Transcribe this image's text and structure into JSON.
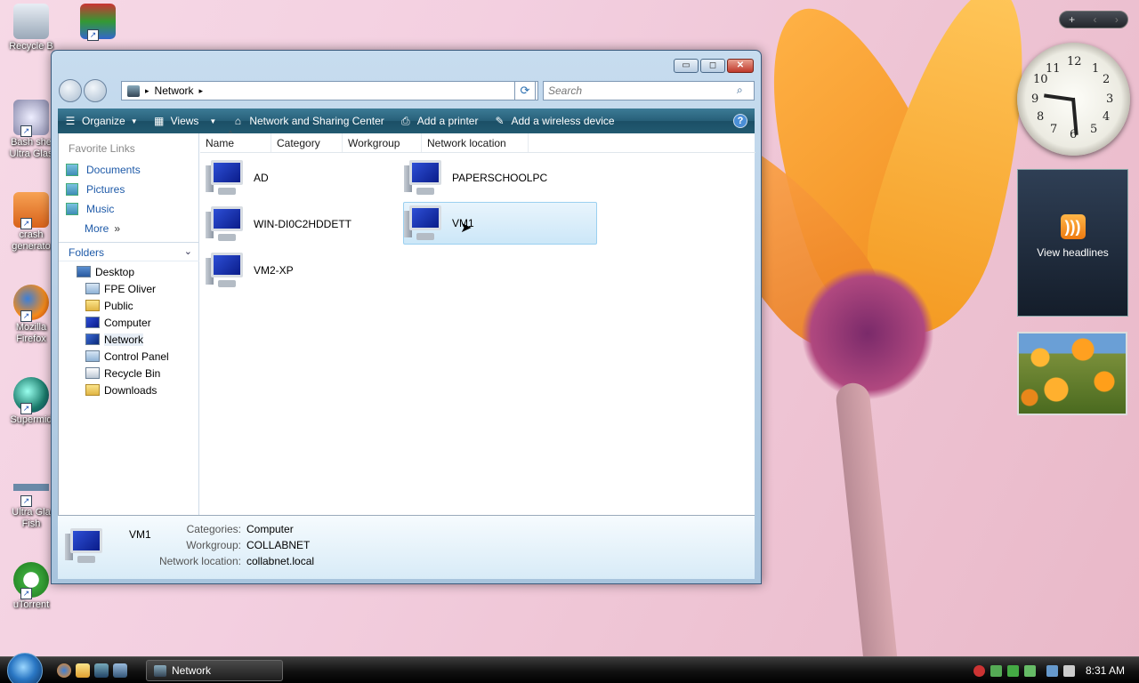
{
  "desktop": {
    "icons": [
      {
        "label": "Recycle B",
        "icon": "recycle-bin-icon"
      },
      {
        "label": "",
        "icon": "winrar-icon"
      },
      {
        "label": "Bash she Ultra Glas",
        "icon": "shell-gear-icon"
      },
      {
        "label": "crash generato",
        "icon": "crash-generator-icon"
      },
      {
        "label": "Mozilla Firefox",
        "icon": "firefox-icon"
      },
      {
        "label": "Supermid",
        "icon": "globe-icon"
      },
      {
        "label": "Ultra Gla Fish",
        "icon": "fish-icon"
      },
      {
        "label": "uTorrent",
        "icon": "utorrent-icon"
      }
    ]
  },
  "gadgets": {
    "clock_numbers": [
      "12",
      "1",
      "2",
      "3",
      "4",
      "5",
      "6",
      "7",
      "8",
      "9",
      "10",
      "11"
    ],
    "feed_label": "View headlines"
  },
  "window": {
    "caption_buttons": {
      "minimize": "▭",
      "maximize": "◻",
      "close": "✕"
    },
    "address": {
      "crumb": "Network",
      "sep": "▸"
    },
    "search_placeholder": "Search",
    "toolbar": {
      "organize": "Organize",
      "views": "Views",
      "network_center": "Network and Sharing Center",
      "add_printer": "Add a printer",
      "add_wireless": "Add a wireless device",
      "help": "?"
    },
    "nav": {
      "favorite_title": "Favorite Links",
      "favorites": [
        "Documents",
        "Pictures",
        "Music"
      ],
      "more": "More",
      "folders_title": "Folders",
      "tree": [
        {
          "label": "Desktop",
          "level": 0,
          "type": "desktop"
        },
        {
          "label": "FPE Oliver",
          "level": 1,
          "type": "user"
        },
        {
          "label": "Public",
          "level": 1,
          "type": "folder"
        },
        {
          "label": "Computer",
          "level": 1,
          "type": "computer"
        },
        {
          "label": "Network",
          "level": 1,
          "type": "network"
        },
        {
          "label": "Control Panel",
          "level": 1,
          "type": "control"
        },
        {
          "label": "Recycle Bin",
          "level": 1,
          "type": "recycle"
        },
        {
          "label": "Downloads",
          "level": 1,
          "type": "folder"
        }
      ]
    },
    "columns": [
      "Name",
      "Category",
      "Workgroup",
      "Network location"
    ],
    "items": [
      "AD",
      "PAPERSCHOOLPC",
      "WIN-DI0C2HDDETT",
      "VM1",
      "VM2-XP"
    ],
    "selected_item": "VM1",
    "details": {
      "name": "VM1",
      "categories_label": "Categories:",
      "categories_value": "Computer",
      "workgroup_label": "Workgroup:",
      "workgroup_value": "COLLABNET",
      "location_label": "Network location:",
      "location_value": "collabnet.local"
    }
  },
  "taskbar": {
    "task_label": "Network",
    "time": "8:31 AM"
  },
  "colors": {
    "toolbar": "#275f78",
    "link": "#1e5aa8",
    "selection": "#cce7f8"
  }
}
